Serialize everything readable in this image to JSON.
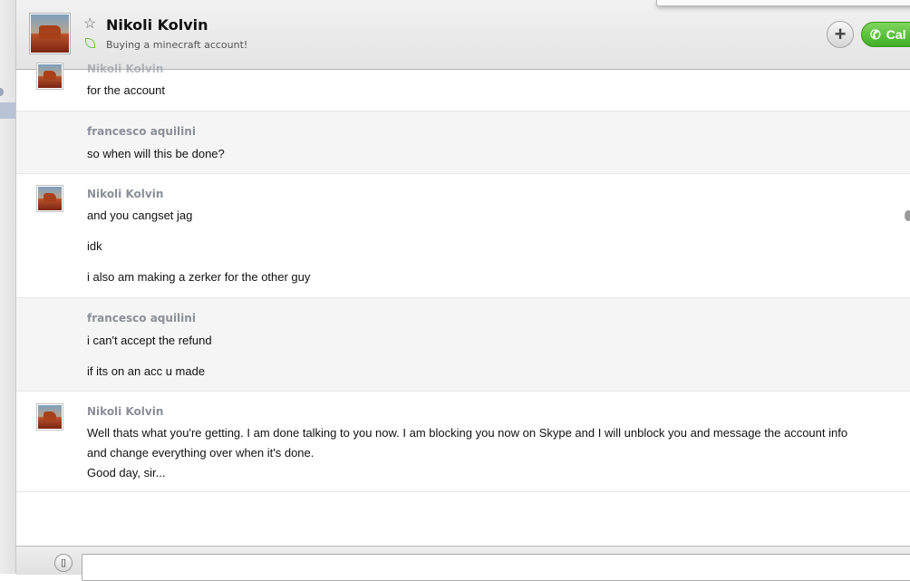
{
  "header": {
    "contact_name": "Nikoli Kolvin",
    "mood": "Buying a minecraft account!",
    "add_symbol": "+",
    "call_label": "Cal"
  },
  "icons": {
    "star": "★",
    "phone": "✆",
    "sms": "▯"
  },
  "messages": [
    {
      "sender": "Nikoli Kolvin",
      "lines": [
        "for the account"
      ]
    },
    {
      "sender": "francesco aquilini",
      "lines": [
        "so when will this be done?"
      ]
    },
    {
      "sender": "Nikoli Kolvin",
      "lines": [
        "and you cangset jag",
        "idk",
        "i also am making a zerker for the other guy"
      ]
    },
    {
      "sender": "francesco aquilini",
      "lines": [
        "i can't accept the refund",
        "if its on an acc u made"
      ]
    },
    {
      "sender": "Nikoli Kolvin",
      "lines": [
        "Well thats what you're getting. I am done talking to you now. I am blocking you now on Skype and I will unblock you and message the account info",
        "and change everything over when it's done.",
        "Good day, sir..."
      ]
    }
  ],
  "input": {
    "value": ""
  },
  "colors": {
    "call_green": "#3fae25",
    "sender_gray": "#8a8f99"
  }
}
